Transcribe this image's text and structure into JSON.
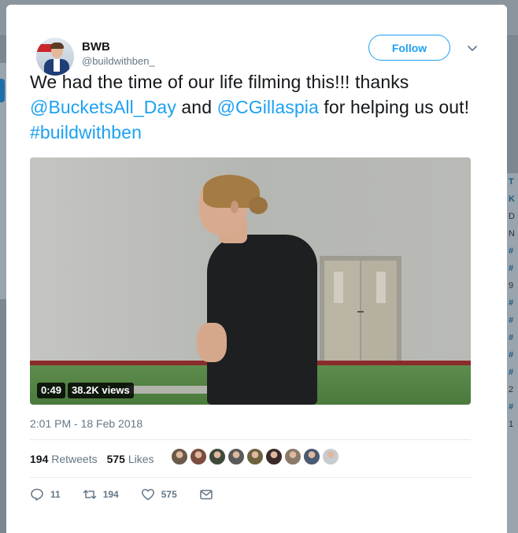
{
  "tweet": {
    "author_name": "BWB",
    "author_handle": "@buildwithben_",
    "follow_label": "Follow",
    "text_parts": [
      "We had the time of our life filming this!!! thanks ",
      "@BucketsAll_Day",
      " and ",
      "@CGillaspia",
      " for helping us out! ",
      "#buildwithben"
    ],
    "video": {
      "duration": "0:49",
      "views": "38.2K views"
    },
    "timestamp": "2:01 PM - 18 Feb 2018",
    "stats": {
      "retweets_count": "194",
      "retweets_label": "Retweets",
      "likes_count": "575",
      "likes_label": "Likes"
    },
    "likers_colors": [
      "#6b5a4a",
      "#7a4d3c",
      "#3d4a3a",
      "#5a5a5a",
      "#6d6240",
      "#3a2a2a",
      "#8a7a6a",
      "#4a5a70",
      "#c8ccd0"
    ],
    "actions": {
      "replies": "11",
      "retweets": "194",
      "likes": "575"
    },
    "accent_color": "#1da1f2"
  }
}
